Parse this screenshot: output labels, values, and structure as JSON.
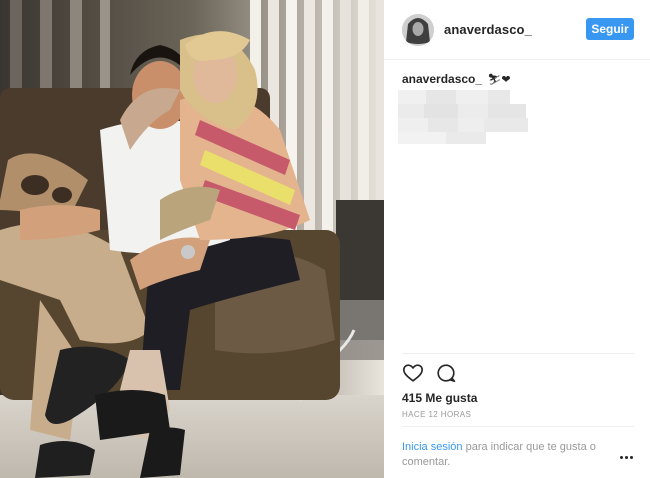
{
  "post": {
    "username": "anaverdasco_",
    "follow_label": "Seguir",
    "caption_user": "anaverdasco_",
    "caption_emoji": "⛷❤",
    "likes_text": "415 Me gusta",
    "timestamp": "HACE 12 HORAS",
    "login_link": "Inicia sesión",
    "login_text": " para indicar que te gusta o comentar.",
    "icons": [
      "heart-icon",
      "comment-icon",
      "more-options-icon"
    ]
  },
  "colors": {
    "accent": "#3897f0",
    "text": "#262626",
    "muted": "#999999",
    "divider": "#efefef"
  }
}
